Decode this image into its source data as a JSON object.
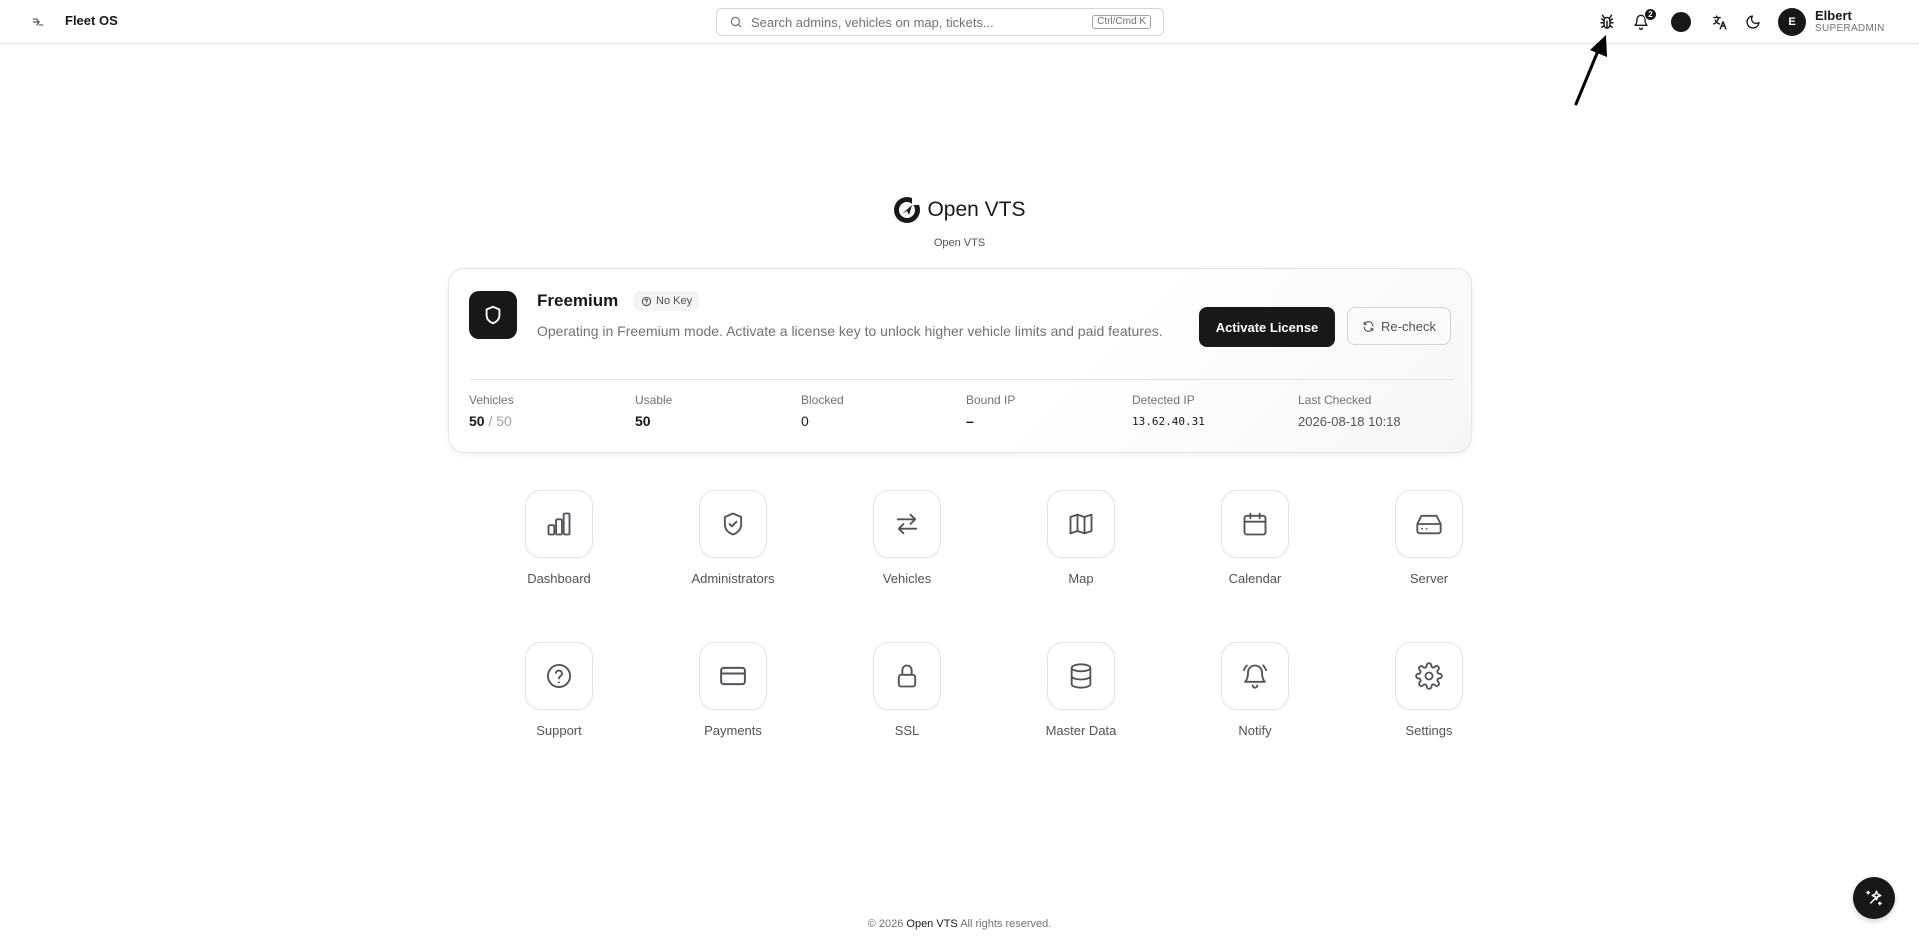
{
  "header": {
    "brand": "Fleet OS",
    "search_placeholder": "Search admins, vehicles on map, tickets...",
    "search_shortcut": "Ctrl/Cmd K",
    "notification_count": "2",
    "user_initial": "E",
    "user_name": "Elbert",
    "user_role": "SUPERADMIN"
  },
  "logo": {
    "title": "Open VTS",
    "subtitle": "Open VTS"
  },
  "license": {
    "plan": "Freemium",
    "badge": "No Key",
    "description": "Operating in Freemium mode. Activate a license key to unlock higher vehicle limits and paid features.",
    "activate_label": "Activate License",
    "recheck_label": "Re-check",
    "stats": {
      "vehicles_label": "Vehicles",
      "vehicles_used": "50",
      "vehicles_total": "/ 50",
      "usable_label": "Usable",
      "usable_value": "50",
      "blocked_label": "Blocked",
      "blocked_value": "0",
      "bound_ip_label": "Bound IP",
      "bound_ip_value": "–",
      "detected_ip_label": "Detected IP",
      "detected_ip_value": "13.62.40.31",
      "last_checked_label": "Last Checked",
      "last_checked_value": "2026-08-18 10:18"
    }
  },
  "tiles": [
    {
      "label": "Dashboard",
      "icon": "bar-chart-icon"
    },
    {
      "label": "Administrators",
      "icon": "shield-check-icon"
    },
    {
      "label": "Vehicles",
      "icon": "arrows-left-right-icon"
    },
    {
      "label": "Map",
      "icon": "map-icon"
    },
    {
      "label": "Calendar",
      "icon": "calendar-icon"
    },
    {
      "label": "Server",
      "icon": "hard-drive-icon"
    },
    {
      "label": "Support",
      "icon": "help-circle-icon"
    },
    {
      "label": "Payments",
      "icon": "credit-card-icon"
    },
    {
      "label": "SSL",
      "icon": "lock-icon"
    },
    {
      "label": "Master Data",
      "icon": "database-icon"
    },
    {
      "label": "Notify",
      "icon": "bell-ring-icon"
    },
    {
      "label": "Settings",
      "icon": "gear-icon"
    }
  ],
  "footer": {
    "copyright": "© 2026",
    "brand": "Open VTS",
    "rights": "All rights reserved."
  }
}
